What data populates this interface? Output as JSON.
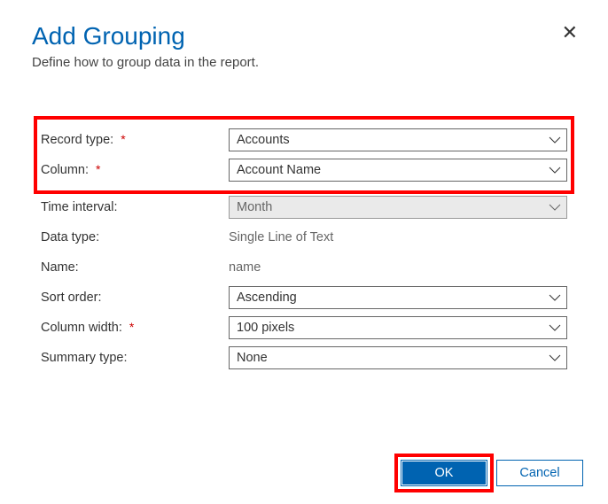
{
  "header": {
    "title": "Add Grouping",
    "subtitle": "Define how to group data in the report."
  },
  "form": {
    "record_type": {
      "label": "Record type:",
      "value": "Accounts",
      "required": true
    },
    "column": {
      "label": "Column:",
      "value": "Account Name",
      "required": true
    },
    "time_interval": {
      "label": "Time interval:",
      "value": "Month"
    },
    "data_type": {
      "label": "Data type:",
      "value": "Single Line of Text"
    },
    "name": {
      "label": "Name:",
      "value": "name"
    },
    "sort_order": {
      "label": "Sort order:",
      "value": "Ascending"
    },
    "column_width": {
      "label": "Column width:",
      "value": "100 pixels",
      "required": true
    },
    "summary_type": {
      "label": "Summary type:",
      "value": "None"
    }
  },
  "footer": {
    "ok": "OK",
    "cancel": "Cancel"
  }
}
